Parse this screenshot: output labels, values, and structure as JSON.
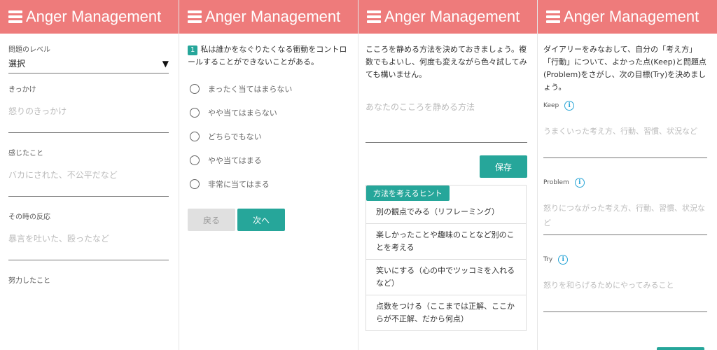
{
  "app": {
    "title": "Anger Management"
  },
  "screen1": {
    "level_label": "問題のレベル",
    "level_value": "選択",
    "fields": [
      {
        "label": "きっかけ",
        "placeholder": "怒りのきっかけ"
      },
      {
        "label": "感じたこと",
        "placeholder": "バカにされた、不公平だなど"
      },
      {
        "label": "その時の反応",
        "placeholder": "暴言を吐いた、殴ったなど"
      },
      {
        "label": "努力したこと",
        "placeholder": ""
      }
    ]
  },
  "screen2": {
    "question_number": "1",
    "question_text": "私は誰かをなぐりたくなる衝動をコントロールすることができないことがある。",
    "options": [
      "まったく当てはまらない",
      "やや当てはまらない",
      "どちらでもない",
      "やや当てはまる",
      "非常に当てはまる"
    ],
    "back_label": "戻る",
    "next_label": "次へ"
  },
  "screen3": {
    "intro": "こころを静める方法を決めておきましょう。複数でもよいし、何度も変えながら色々試してみても構いません。",
    "calm_placeholder": "あなたのこころを静める方法",
    "save_label": "保存",
    "hint_title": "方法を考えるヒント",
    "hints": [
      "別の観点でみる（リフレーミング）",
      "楽しかったことや趣味のことなど別のことを考える",
      "笑いにする（心の中でツッコミを入れるなど）",
      "点数をつける（ここまでは正解、ここからが不正解、だから何点）"
    ]
  },
  "screen4": {
    "intro": "ダイアリーをみなおして、自分の「考え方」「行動」について、よかった点(Keep)と問題点(Problem)をさがし、次の目標(Try)を決めましょう。",
    "items": [
      {
        "label": "Keep",
        "placeholder": "うまくいった考え方、行動、習慣、状況など"
      },
      {
        "label": "Problem",
        "placeholder": "怒りにつながった考え方、行動、習慣、状況など"
      },
      {
        "label": "Try",
        "placeholder": "怒りを和らげるためにやってみること"
      }
    ]
  },
  "colors": {
    "appbar": "#ee7b7b",
    "accent": "#26a69a",
    "info": "#29a5d6"
  },
  "icons": {
    "menu": "hamburger-menu-icon",
    "info": "info-icon",
    "dropdown": "dropdown-arrow-icon",
    "radio": "radio-button-icon"
  }
}
